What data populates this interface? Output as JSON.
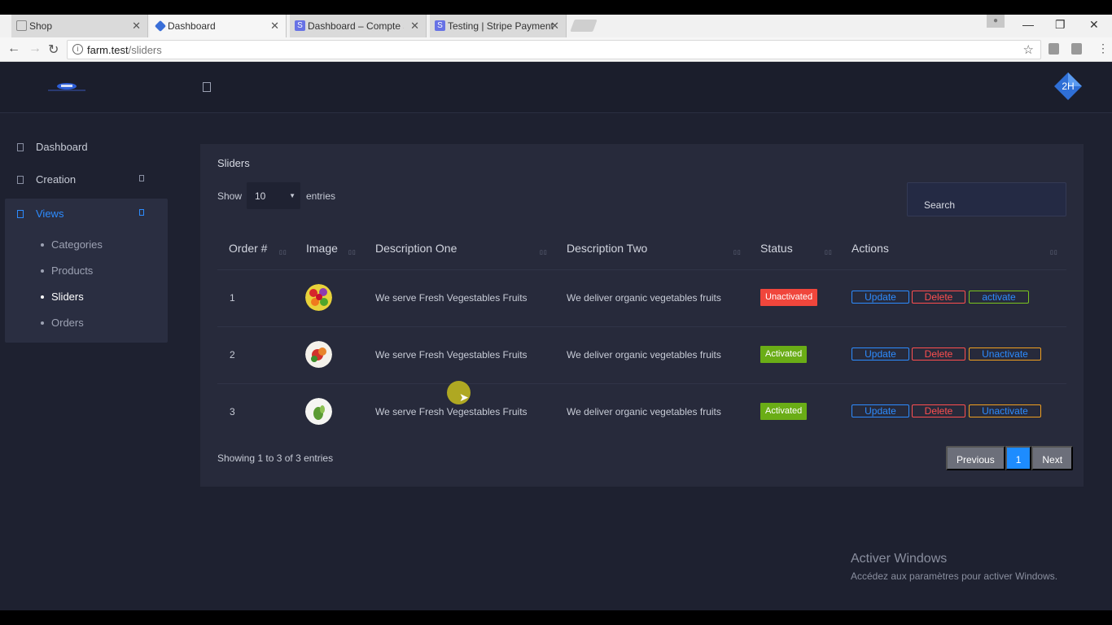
{
  "browser": {
    "tabs": [
      {
        "label": "Shop",
        "icon": "page-icon",
        "active": false
      },
      {
        "label": "Dashboard",
        "icon": "diamond-icon",
        "active": true
      },
      {
        "label": "Dashboard – Compte sar",
        "icon": "stripe-icon",
        "active": false
      },
      {
        "label": "Testing | Stripe Payments",
        "icon": "stripe-icon",
        "active": false
      }
    ],
    "url_host": "farm.test",
    "url_path": "/sliders"
  },
  "sidebar": {
    "items": [
      {
        "label": "Dashboard"
      },
      {
        "label": "Creation"
      },
      {
        "label": "Views"
      }
    ],
    "sub_items": [
      {
        "label": "Categories"
      },
      {
        "label": "Products"
      },
      {
        "label": "Sliders"
      },
      {
        "label": "Orders"
      }
    ]
  },
  "avatar_text": "2H",
  "card": {
    "title": "Sliders",
    "show_label": "Show",
    "entries_value": "10",
    "entries_label": "entries",
    "search_placeholder": "Search",
    "columns": [
      "Order #",
      "Image",
      "Description One",
      "Description Two",
      "Status",
      "Actions"
    ],
    "rows": [
      {
        "order": "1",
        "desc_one": "We serve Fresh Vegestables Fruits",
        "desc_two": "We deliver organic vegetables fruits",
        "status": "Unactivated",
        "actions": [
          "Update",
          "Delete",
          "activate"
        ]
      },
      {
        "order": "2",
        "desc_one": "We serve Fresh Vegestables Fruits",
        "desc_two": "We deliver organic vegetables fruits",
        "status": "Activated",
        "actions": [
          "Update",
          "Delete",
          "Unactivate"
        ]
      },
      {
        "order": "3",
        "desc_one": "We serve Fresh Vegestables Fruits",
        "desc_two": "We deliver organic vegetables fruits",
        "status": "Activated",
        "actions": [
          "Update",
          "Delete",
          "Unactivate"
        ]
      }
    ],
    "showing_text": "Showing 1 to 3 of 3 entries",
    "pager": {
      "previous": "Previous",
      "current": "1",
      "next": "Next"
    }
  },
  "watermark": {
    "title": "Activer Windows",
    "subtitle": "Accédez aux paramètres pour activer Windows."
  },
  "colors": {
    "accent": "#2d8cff",
    "danger": "#ff4f4f",
    "success": "#6aad16",
    "unactivated": "#f0463c",
    "background": "#1e2130",
    "card": "#272a3b"
  }
}
